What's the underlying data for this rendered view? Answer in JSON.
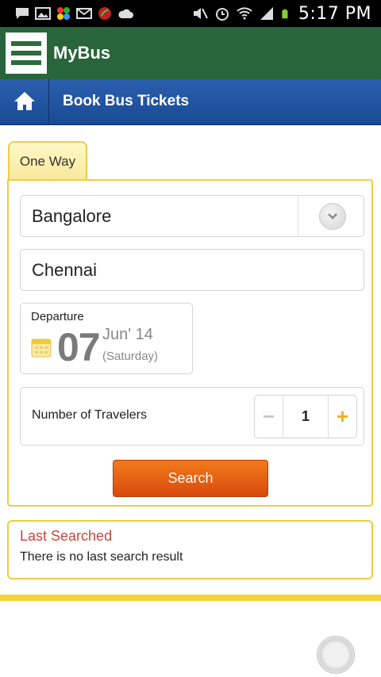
{
  "status_bar": {
    "time": "5:17 PM",
    "left_icons": [
      "chat-icon",
      "image-icon",
      "pinwheel-icon",
      "mail-icon",
      "app-icon",
      "cloud-icon"
    ],
    "right_icons": [
      "mute-icon",
      "alarm-icon",
      "wifi-icon",
      "signal-icon",
      "battery-icon"
    ]
  },
  "app_bar": {
    "title": "MyBus",
    "color": "#28653a"
  },
  "sub_bar": {
    "title": "Book Bus Tickets",
    "color": "#1f4f9e"
  },
  "tabs": [
    {
      "label": "One Way",
      "active": true
    }
  ],
  "form": {
    "from": "Bangalore",
    "to": "Chennai",
    "departure": {
      "label": "Departure",
      "day": "07",
      "month_year": "Jun' 14",
      "weekday": "(Saturday)"
    },
    "travelers": {
      "label": "Number of Travelers",
      "minus": "−",
      "value": "1",
      "plus": "+"
    },
    "search_label": "Search"
  },
  "last_searched": {
    "title": "Last Searched",
    "message": "There is no last search result"
  },
  "colors": {
    "accent_yellow": "#f1cc45",
    "search_orange": "#e35f12",
    "last_searched_red": "#c8463c"
  }
}
